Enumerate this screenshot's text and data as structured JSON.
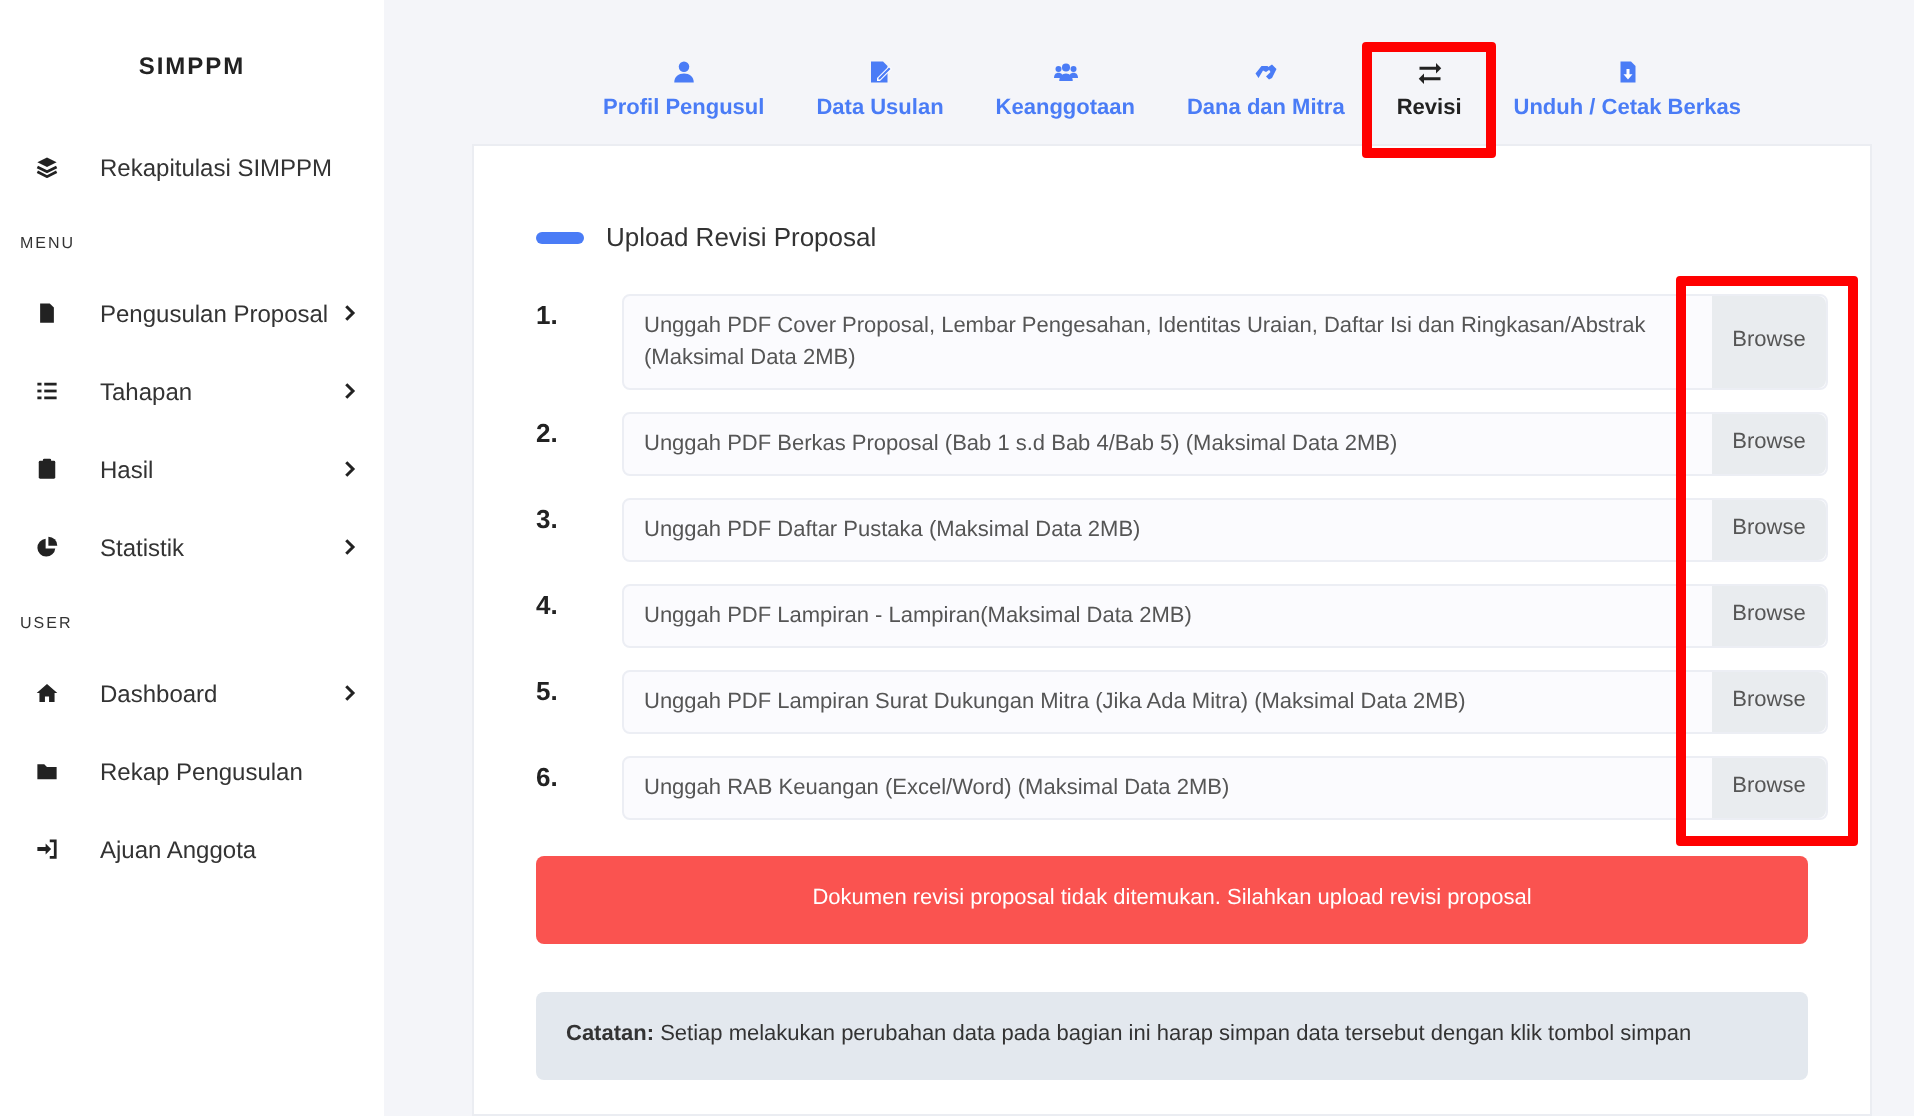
{
  "sidebar": {
    "brand": "SIMPPM",
    "sections": [
      {
        "items": [
          {
            "label": "Rekapitulasi SIMPPM",
            "has_submenu": false
          }
        ]
      },
      {
        "heading": "MENU",
        "items": [
          {
            "label": "Pengusulan Proposal",
            "has_submenu": true
          },
          {
            "label": "Tahapan",
            "has_submenu": true
          },
          {
            "label": "Hasil",
            "has_submenu": true
          },
          {
            "label": "Statistik",
            "has_submenu": true
          }
        ]
      },
      {
        "heading": "USER",
        "items": [
          {
            "label": "Dashboard",
            "has_submenu": true
          },
          {
            "label": "Rekap Pengusulan",
            "has_submenu": false
          },
          {
            "label": "Ajuan Anggota",
            "has_submenu": false
          }
        ]
      }
    ]
  },
  "tabs": [
    {
      "label": "Profil Pengusul",
      "selected": false,
      "highlighted": false
    },
    {
      "label": "Data Usulan",
      "selected": false,
      "highlighted": false
    },
    {
      "label": "Keanggotaan",
      "selected": false,
      "highlighted": false
    },
    {
      "label": "Dana dan Mitra",
      "selected": false,
      "highlighted": false
    },
    {
      "label": "Revisi",
      "selected": true,
      "highlighted": true
    },
    {
      "label": "Unduh / Cetak Berkas",
      "selected": false,
      "highlighted": false
    }
  ],
  "upload": {
    "title": "Upload Revisi Proposal",
    "browse_column_highlighted": true,
    "files": [
      {
        "number": "1.",
        "placeholder": "Unggah PDF Cover Proposal, Lembar Pengesahan, Identitas Uraian, Daftar Isi dan Ringkasan/Abstrak (Maksimal Data 2MB)",
        "button": "Browse"
      },
      {
        "number": "2.",
        "placeholder": "Unggah PDF Berkas Proposal (Bab 1 s.d Bab 4/Bab 5) (Maksimal Data 2MB)",
        "button": "Browse"
      },
      {
        "number": "3.",
        "placeholder": "Unggah PDF Daftar Pustaka (Maksimal Data 2MB)",
        "button": "Browse"
      },
      {
        "number": "4.",
        "placeholder": "Unggah PDF Lampiran - Lampiran(Maksimal Data 2MB)",
        "button": "Browse"
      },
      {
        "number": "5.",
        "placeholder": "Unggah PDF Lampiran Surat Dukungan Mitra (Jika Ada Mitra) (Maksimal Data 2MB)",
        "button": "Browse"
      },
      {
        "number": "6.",
        "placeholder": "Unggah RAB Keuangan (Excel/Word) (Maksimal Data 2MB)",
        "button": "Browse"
      }
    ],
    "alert": "Dokumen revisi proposal tidak ditemukan. Silahkan upload revisi proposal",
    "note": "**Catatan:** Setiap melakukan perubahan data pada bagian ini harap simpan data tersebut dengan klik tombol simpan"
  }
}
